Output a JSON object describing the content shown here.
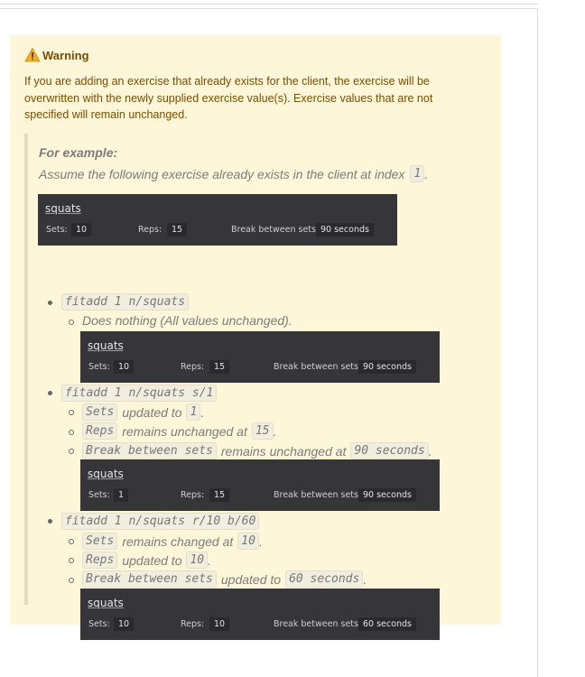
{
  "warning": {
    "title": "Warning",
    "icon": "warning-icon",
    "text": "If you are adding an exercise that already exists for the client, the exercise will be overwritten with the newly supplied exercise value(s). Exercise values that are not specified will remain unchanged."
  },
  "example": {
    "heading": "For example:",
    "assume_text": "Assume the following exercise already exists in the client at index",
    "index": "1",
    "period": "."
  },
  "labels": {
    "sets": "Sets:",
    "reps": "Reps:",
    "break": "Break between sets:"
  },
  "initial_card": {
    "name": "squats",
    "sets": "10",
    "reps": "15",
    "break": "90 seconds"
  },
  "commands": [
    {
      "command": "fitadd 1 n/squats",
      "note": "Does nothing (All values unchanged).",
      "card": {
        "name": "squats",
        "sets": "10",
        "reps": "15",
        "break": "90 seconds"
      }
    },
    {
      "command": "fitadd 1 n/squats s/1",
      "items": [
        {
          "field": "Sets",
          "text": "updated to",
          "value": "1"
        },
        {
          "field": "Reps",
          "text": "remains unchanged at",
          "value": "15"
        },
        {
          "field": "Break between sets",
          "text": "remains unchanged at",
          "value": "90 seconds"
        }
      ],
      "card": {
        "name": "squats",
        "sets": "1",
        "reps": "15",
        "break": "90 seconds"
      }
    },
    {
      "command": "fitadd 1 n/squats r/10 b/60",
      "items": [
        {
          "field": "Sets",
          "text": "remains changed at",
          "value": "10"
        },
        {
          "field": "Reps",
          "text": "updated to",
          "value": "10"
        },
        {
          "field": "Break between sets",
          "text": "updated to",
          "value": "60 seconds"
        }
      ],
      "card": {
        "name": "squats",
        "sets": "10",
        "reps": "10",
        "break": "60 seconds"
      }
    }
  ],
  "colors": {
    "warning_bg": "#fef6d8",
    "warning_text": "#7a4d00",
    "card_bg": "#36363a"
  }
}
